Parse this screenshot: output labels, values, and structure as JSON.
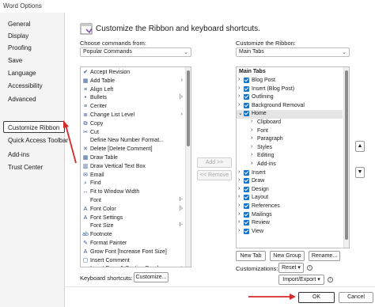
{
  "window": {
    "title": "Word Options"
  },
  "sidebar": {
    "items": [
      {
        "label": "General"
      },
      {
        "label": "Display"
      },
      {
        "label": "Proofing"
      },
      {
        "label": "Save"
      },
      {
        "label": "Language"
      },
      {
        "label": "Accessibility"
      },
      {
        "label": "Advanced"
      },
      {
        "label": "Customize Ribbon",
        "selected": true
      },
      {
        "label": "Quick Access Toolbar"
      },
      {
        "label": "Add-ins"
      },
      {
        "label": "Trust Center"
      }
    ]
  },
  "main": {
    "heading": "Customize the Ribbon and keyboard shortcuts.",
    "choose_label": "Choose commands from:",
    "choose_value": "Popular Commands",
    "customize_label": "Customize the Ribbon:",
    "customize_value": "Main Tabs",
    "commands": [
      {
        "icon": "accept-revision-icon",
        "glyph": "✔",
        "label": "Accept Revision"
      },
      {
        "icon": "add-table-icon",
        "glyph": "▦",
        "label": "Add Table",
        "submenu": "›"
      },
      {
        "icon": "align-left-icon",
        "glyph": "≡",
        "label": "Align Left"
      },
      {
        "icon": "bullets-icon",
        "glyph": "•",
        "label": "Bullets",
        "submenu": "|›"
      },
      {
        "icon": "center-icon",
        "glyph": "≡",
        "label": "Center"
      },
      {
        "icon": "change-list-level-icon",
        "glyph": "≣",
        "label": "Change List Level",
        "submenu": "›"
      },
      {
        "icon": "copy-icon",
        "glyph": "⧉",
        "label": "Copy"
      },
      {
        "icon": "cut-icon",
        "glyph": "✂",
        "label": "Cut"
      },
      {
        "icon": "define-number-format-icon",
        "glyph": "",
        "label": "Define New Number Format..."
      },
      {
        "icon": "delete-comment-icon",
        "glyph": "✕",
        "label": "Delete [Delete Comment]"
      },
      {
        "icon": "draw-table-icon",
        "glyph": "▦",
        "label": "Draw Table"
      },
      {
        "icon": "draw-vertical-text-box-icon",
        "glyph": "▥",
        "label": "Draw Vertical Text Box"
      },
      {
        "icon": "email-icon",
        "glyph": "✉",
        "label": "Email"
      },
      {
        "icon": "find-icon",
        "glyph": "⌕",
        "label": "Find"
      },
      {
        "icon": "fit-to-window-width-icon",
        "glyph": "↔",
        "label": "Fit to Window Width"
      },
      {
        "icon": "font-icon",
        "glyph": "",
        "label": "Font",
        "submenu": "I-"
      },
      {
        "icon": "font-color-icon",
        "glyph": "A",
        "label": "Font Color",
        "submenu": "|›"
      },
      {
        "icon": "font-settings-icon",
        "glyph": "A",
        "label": "Font Settings"
      },
      {
        "icon": "font-size-icon",
        "glyph": "",
        "label": "Font Size",
        "submenu": "I-"
      },
      {
        "icon": "footnote-icon",
        "glyph": "ab",
        "label": "Footnote"
      },
      {
        "icon": "format-painter-icon",
        "glyph": "✎",
        "label": "Format Painter"
      },
      {
        "icon": "grow-font-icon",
        "glyph": "A",
        "label": "Grow Font [Increase Font Size]"
      },
      {
        "icon": "insert-comment-icon",
        "glyph": "▢",
        "label": "Insert Comment"
      },
      {
        "icon": "insert-page-section-breaks-icon",
        "glyph": "⋯",
        "label": "Insert Page & Section Breaks",
        "submenu": "›"
      }
    ],
    "add_button": "Add >>",
    "remove_button": "<< Remove",
    "ribbon_header": "Main Tabs",
    "ribbon_tabs": [
      {
        "label": "Blog Post",
        "level": 0,
        "expander": "›"
      },
      {
        "label": "Insert (Blog Post)",
        "level": 0,
        "expander": "›"
      },
      {
        "label": "Outlining",
        "level": 0,
        "expander": "›"
      },
      {
        "label": "Background Removal",
        "level": 0,
        "expander": "›"
      },
      {
        "label": "Home",
        "level": 0,
        "expander": "⌄",
        "highlight": true
      },
      {
        "label": "Clipboard",
        "level": 1,
        "expander": "›",
        "nocheck": true
      },
      {
        "label": "Font",
        "level": 1,
        "expander": "›",
        "nocheck": true
      },
      {
        "label": "Paragraph",
        "level": 1,
        "expander": "›",
        "nocheck": true
      },
      {
        "label": "Styles",
        "level": 1,
        "expander": "›",
        "nocheck": true
      },
      {
        "label": "Editing",
        "level": 1,
        "expander": "›",
        "nocheck": true
      },
      {
        "label": "Add-ins",
        "level": 1,
        "expander": "›",
        "nocheck": true
      },
      {
        "label": "Insert",
        "level": 0,
        "expander": "›"
      },
      {
        "label": "Draw",
        "level": 0,
        "expander": "›"
      },
      {
        "label": "Design",
        "level": 0,
        "expander": "›"
      },
      {
        "label": "Layout",
        "level": 0,
        "expander": "›"
      },
      {
        "label": "References",
        "level": 0,
        "expander": "›"
      },
      {
        "label": "Mailings",
        "level": 0,
        "expander": "›"
      },
      {
        "label": "Review",
        "level": 0,
        "expander": "›"
      },
      {
        "label": "View",
        "level": 0,
        "expander": "›"
      }
    ],
    "new_tab": "New Tab",
    "new_group": "New Group",
    "rename": "Rename...",
    "customizations_label": "Customizations:",
    "reset_button": "Reset ▾",
    "import_export_button": "Import/Export ▾",
    "keyboard_label": "Keyboard shortcuts:",
    "customize_button": "Customize..."
  },
  "footer": {
    "ok": "OK",
    "cancel": "Cancel"
  },
  "colors": {
    "checkbox": "#1a73c8",
    "annotation_arrow": "#d42a2a"
  }
}
